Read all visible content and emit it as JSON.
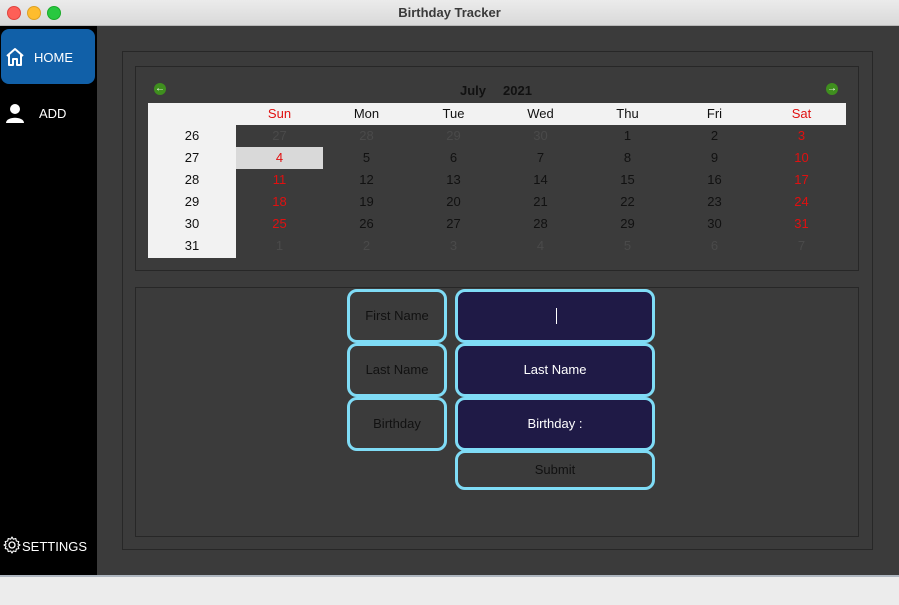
{
  "window": {
    "title": "Birthday Tracker"
  },
  "sidebar": {
    "items": [
      {
        "label": "HOME",
        "icon": "home-icon"
      },
      {
        "label": "ADD",
        "icon": "user-icon"
      },
      {
        "label": "SETTINGS",
        "icon": "gear-icon"
      }
    ]
  },
  "calendar": {
    "prev_icon": "arrow-left-icon",
    "next_icon": "arrow-right-icon",
    "month": "July",
    "year": "2021",
    "weekdays": [
      "Sun",
      "Mon",
      "Tue",
      "Wed",
      "Thu",
      "Fri",
      "Sat"
    ],
    "weeks": [
      {
        "num": "26",
        "days": [
          "27",
          "28",
          "29",
          "30",
          "1",
          "2",
          "3"
        ]
      },
      {
        "num": "27",
        "days": [
          "4",
          "5",
          "6",
          "7",
          "8",
          "9",
          "10"
        ]
      },
      {
        "num": "28",
        "days": [
          "11",
          "12",
          "13",
          "14",
          "15",
          "16",
          "17"
        ]
      },
      {
        "num": "29",
        "days": [
          "18",
          "19",
          "20",
          "21",
          "22",
          "23",
          "24"
        ]
      },
      {
        "num": "30",
        "days": [
          "25",
          "26",
          "27",
          "28",
          "29",
          "30",
          "31"
        ]
      },
      {
        "num": "31",
        "days": [
          "1",
          "2",
          "3",
          "4",
          "5",
          "6",
          "7"
        ]
      }
    ],
    "selected_day": "4",
    "colors": {
      "weekend": "#e01010",
      "outside_month": "#4a4a4a",
      "header_bg": "#f2f2f2",
      "selected_bg": "#d9d9d9"
    }
  },
  "form": {
    "labels": {
      "first_name": "First Name",
      "last_name": "Last Name",
      "birthday": "Birthday"
    },
    "fields": {
      "first_name_value": "",
      "last_name_value": "Last Name",
      "birthday_value": "Birthday :"
    },
    "submit_label": "Submit",
    "colors": {
      "border": "#7fdcf6",
      "field_bg": "#1f1a46"
    }
  },
  "colors": {
    "accent": "#1160a8",
    "sidebar_bg": "#000000",
    "main_bg": "#3b3b3b"
  }
}
